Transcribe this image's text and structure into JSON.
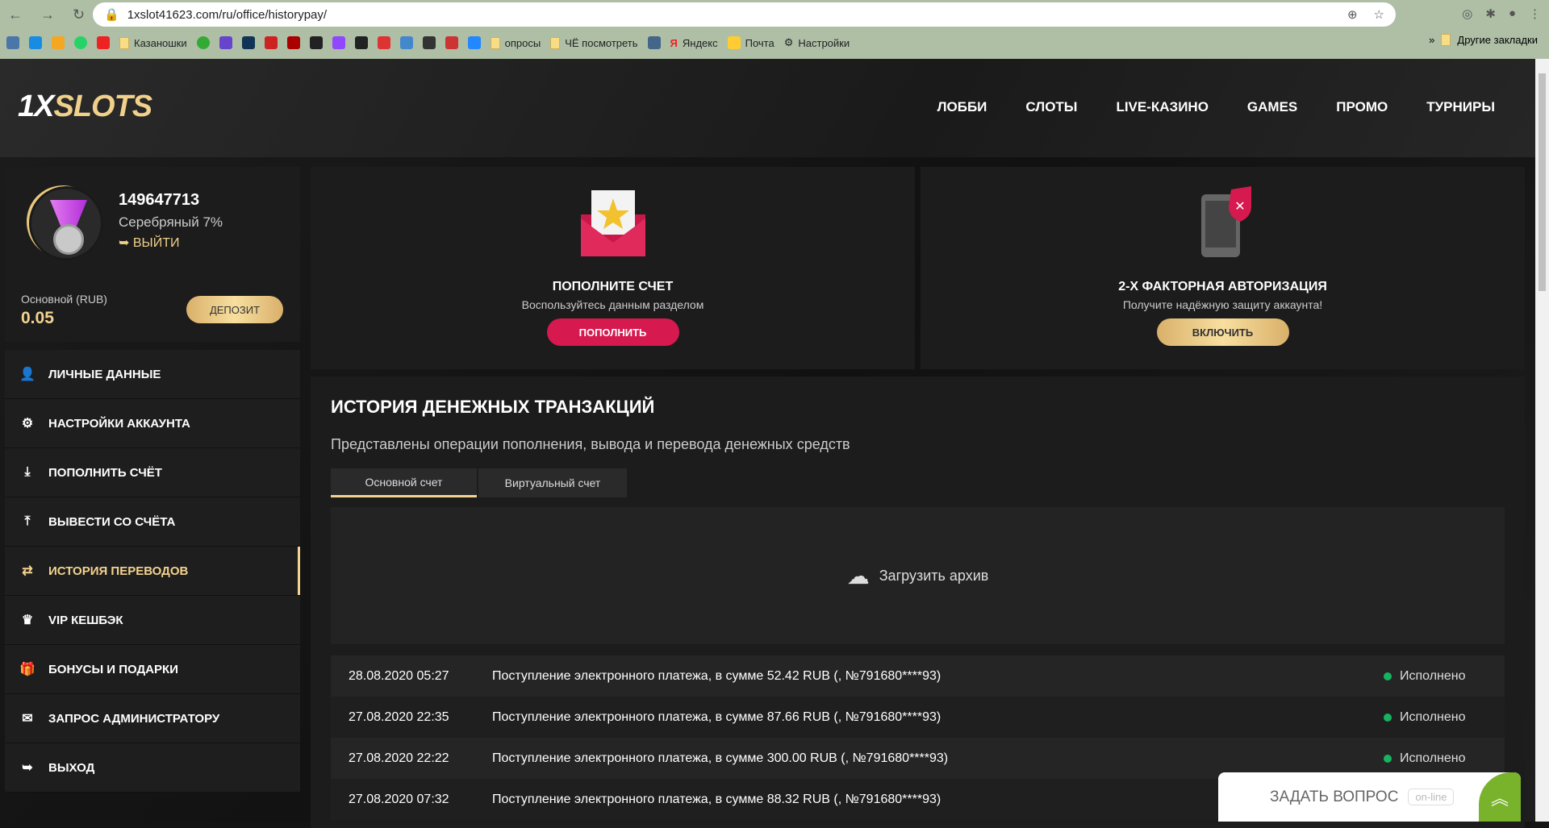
{
  "browser": {
    "url": "1xslot41623.com/ru/office/historypay/",
    "bookmarks": [
      "Казаношки",
      "опросы",
      "ЧЁ посмотреть",
      "Яндекс",
      "Почта",
      "Настройки"
    ],
    "other_bookmarks": "Другие закладки",
    "more": "»"
  },
  "header": {
    "logo_a": "1X",
    "logo_b": "SLOTS",
    "nav": [
      "ЛОББИ",
      "СЛОТЫ",
      "LIVE-КАЗИНО",
      "GAMES",
      "ПРОМО",
      "ТУРНИРЫ"
    ]
  },
  "profile": {
    "id": "149647713",
    "level": "Серебряный 7%",
    "logout": "ВЫЙТИ",
    "balance_label": "Основной (RUB)",
    "balance": "0.05",
    "deposit": "ДЕПОЗИТ"
  },
  "menu": [
    {
      "label": "ЛИЧНЫЕ ДАННЫЕ",
      "icon": "user-icon"
    },
    {
      "label": "НАСТРОЙКИ АККАУНТА",
      "icon": "gears-icon"
    },
    {
      "label": "ПОПОЛНИТЬ СЧЁТ",
      "icon": "download-icon"
    },
    {
      "label": "ВЫВЕСТИ СО СЧЁТА",
      "icon": "upload-icon"
    },
    {
      "label": "ИСТОРИЯ ПЕРЕВОДОВ",
      "icon": "transfer-icon"
    },
    {
      "label": "VIP КЕШБЭК",
      "icon": "crown-icon"
    },
    {
      "label": "БОНУСЫ И ПОДАРКИ",
      "icon": "gift-icon"
    },
    {
      "label": "ЗАПРОС АДМИНИСТРАТОРУ",
      "icon": "envelope-icon"
    },
    {
      "label": "ВЫХОД",
      "icon": "logout-icon"
    }
  ],
  "cards": [
    {
      "title": "ПОПОЛНИТЕ СЧЕТ",
      "text": "Воспользуйтесь данным разделом",
      "button": "ПОПОЛНИТЬ"
    },
    {
      "title": "2-Х ФАКТОРНАЯ АВТОРИЗАЦИЯ",
      "text": "Получите надёжную защиту аккаунта!",
      "button": "ВКЛЮЧИТЬ"
    }
  ],
  "history": {
    "title": "ИСТОРИЯ ДЕНЕЖНЫХ ТРАНЗАКЦИЙ",
    "subtitle": "Представлены операции пополнения, вывода и перевода денежных средств",
    "tabs": [
      "Основной счет",
      "Виртуальный счет"
    ],
    "archive": "Загрузить архив",
    "rows": [
      {
        "date": "28.08.2020 05:27",
        "text": "Поступление электронного платежа, в сумме 52.42 RUB (, №791680****93)",
        "status": "Исполнено"
      },
      {
        "date": "27.08.2020 22:35",
        "text": "Поступление электронного платежа, в сумме 87.66 RUB (, №791680****93)",
        "status": "Исполнено"
      },
      {
        "date": "27.08.2020 22:22",
        "text": "Поступление электронного платежа, в сумме 300.00 RUB (, №791680****93)",
        "status": "Исполнено"
      },
      {
        "date": "27.08.2020 07:32",
        "text": "Поступление электронного платежа, в сумме 88.32 RUB (, №791680****93)",
        "status": ""
      }
    ]
  },
  "chat": {
    "label": "ЗАДАТЬ ВОПРОС",
    "status": "on-line"
  }
}
